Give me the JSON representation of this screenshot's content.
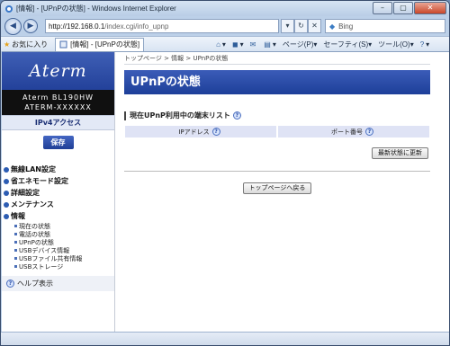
{
  "window": {
    "title": "[情報] - [UPnPの状態] - Windows Internet Explorer",
    "controls": {
      "minimize": "–",
      "maximize": "▢",
      "close": "✕"
    }
  },
  "addressbar": {
    "host": "http://192.168.0.1",
    "path": "/index.cgi/info_upnp",
    "search_placeholder": "Bing"
  },
  "favorites": {
    "label": "お気に入り",
    "tab_title": "[情報] - [UPnPの状態]",
    "commands": [
      "ページ(P)",
      "セーフティ(S)",
      "ツール(O)"
    ]
  },
  "sidebar": {
    "logo": "Aterm",
    "model_line1": "Aterm BL190HW",
    "model_line2": "ATERM-XXXXXX",
    "mode": "IPv4アクセス",
    "save_label": "保存",
    "menu": [
      "無線LAN設定",
      "省エネモード設定",
      "詳細設定",
      "メンテナンス",
      "情報"
    ],
    "submenu": [
      "現在の状態",
      "電話の状態",
      "UPnPの状態",
      "USBデバイス情報",
      "USBファイル共有情報",
      "USBストレージ"
    ],
    "help": "ヘルプ表示"
  },
  "main": {
    "breadcrumb": "トップページ > 情報 > UPnPの状態",
    "title": "UPnPの状態",
    "section_title": "現在UPnP利用中の端末リスト",
    "columns": [
      "IPアドレス",
      "ポート番号"
    ],
    "refresh_label": "最新状態に更新",
    "back_label": "トップページへ戻る"
  }
}
